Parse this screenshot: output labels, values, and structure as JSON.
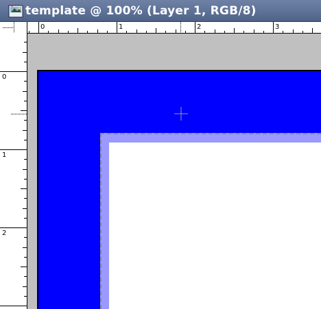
{
  "window": {
    "title": "template @ 100% (Layer 1, RGB/8)",
    "app_icon": "photoshop-document-icon"
  },
  "ruler_top": {
    "labels": [
      "0",
      "1",
      "2",
      "3"
    ]
  },
  "ruler_left": {
    "labels": [
      "0",
      "1",
      "2"
    ]
  },
  "canvas": {
    "layer_color": "#0000ff",
    "selection_border_color": "#9999ff",
    "selection_fill_color": "#ffffff",
    "pasteboard_color": "#c0c0c0",
    "cursor": "crosshair-icon"
  },
  "colors": {
    "titlebar": "#5a6d93",
    "title_text": "#ffffff"
  }
}
